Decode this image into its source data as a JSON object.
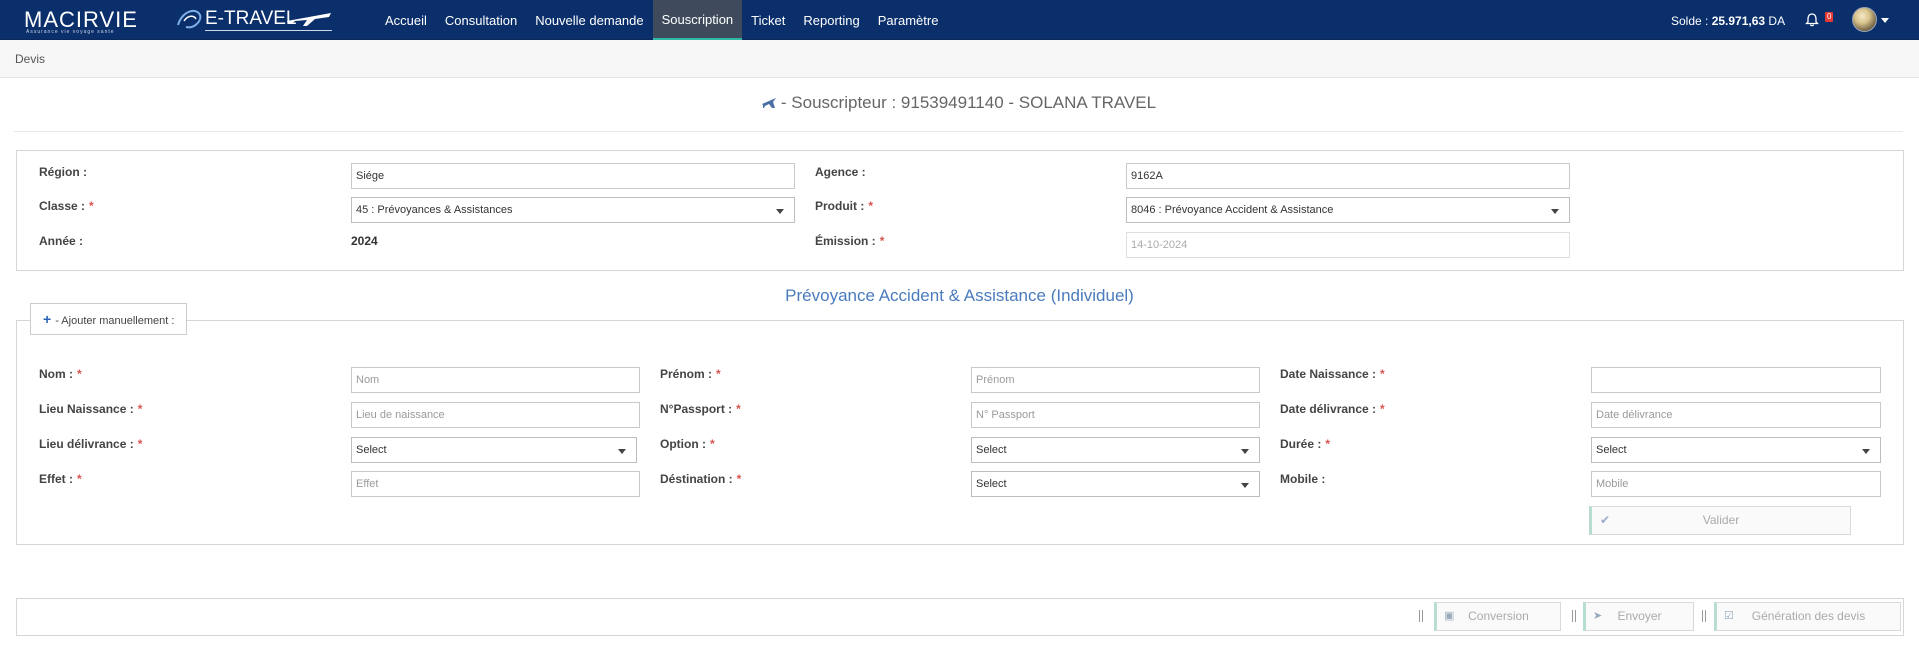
{
  "header": {
    "brand_name": "MACIRVIE",
    "brand_tagline": "Assurance vie voyage sante",
    "app_name": "E-TRAVEL",
    "nav": [
      {
        "label": "Accueil",
        "active": false
      },
      {
        "label": "Consultation",
        "active": false
      },
      {
        "label": "Nouvelle demande",
        "active": false
      },
      {
        "label": "Souscription",
        "active": true
      },
      {
        "label": "Ticket",
        "active": false
      },
      {
        "label": "Reporting",
        "active": false
      },
      {
        "label": "Paramètre",
        "active": false
      }
    ],
    "solde_label": "Solde : ",
    "solde_value": "25.971,63",
    "solde_currency": " DA",
    "notification_count": "0",
    "colors": {
      "navbar": "#0b2f6b",
      "active_tab": "#3f4b5c",
      "accent": "#2fb8a6"
    }
  },
  "breadcrumb": {
    "label": "Devis"
  },
  "page_title": {
    "text": "- Souscripteur : 91539491140 - SOLANA TRAVEL",
    "icon": "plane-icon"
  },
  "general": {
    "region": {
      "label": "Région :",
      "value": "Siége"
    },
    "agence": {
      "label": "Agence :",
      "value": "9162A"
    },
    "classe": {
      "label": "Classe :",
      "required": "*",
      "value": "45 : Prévoyances & Assistances"
    },
    "produit": {
      "label": "Produit :",
      "required": "*",
      "value": "8046 : Prévoyance Accident & Assistance"
    },
    "annee": {
      "label": "Année :",
      "value": "2024"
    },
    "emission": {
      "label": "Émission :",
      "required": "*",
      "value": "14-10-2024"
    }
  },
  "section_title": "Prévoyance Accident & Assistance (Individuel)",
  "add_manual": {
    "label": "- Ajouter manuellement :"
  },
  "form": {
    "nom": {
      "label": "Nom :",
      "required": "*",
      "placeholder": "Nom"
    },
    "prenom": {
      "label": "Prénom :",
      "required": "*",
      "placeholder": "Prénom"
    },
    "date_naissance": {
      "label": "Date Naissance :",
      "required": "*",
      "value": ""
    },
    "lieu_naissance": {
      "label": "Lieu Naissance :",
      "required": "*",
      "placeholder": "Lieu de naissance"
    },
    "passport": {
      "label": "N°Passport :",
      "required": "*",
      "placeholder": "N° Passport"
    },
    "date_delivrance": {
      "label": "Date délivrance :",
      "required": "*",
      "placeholder": "Date délivrance"
    },
    "lieu_delivrance": {
      "label": "Lieu délivrance :",
      "required": "*",
      "value": "Select"
    },
    "option": {
      "label": "Option :",
      "required": "*",
      "value": "Select"
    },
    "duree": {
      "label": "Durée :",
      "required": "*",
      "value": "Select"
    },
    "effet": {
      "label": "Effet :",
      "required": "*",
      "placeholder": "Effet"
    },
    "destination": {
      "label": "Déstination :",
      "required": "*",
      "value": "Select"
    },
    "mobile": {
      "label": "Mobile :",
      "placeholder": "Mobile"
    },
    "valider": "Valider"
  },
  "actions": {
    "conversion": "Conversion",
    "envoyer": "Envoyer",
    "generation": "Génération des devis"
  }
}
